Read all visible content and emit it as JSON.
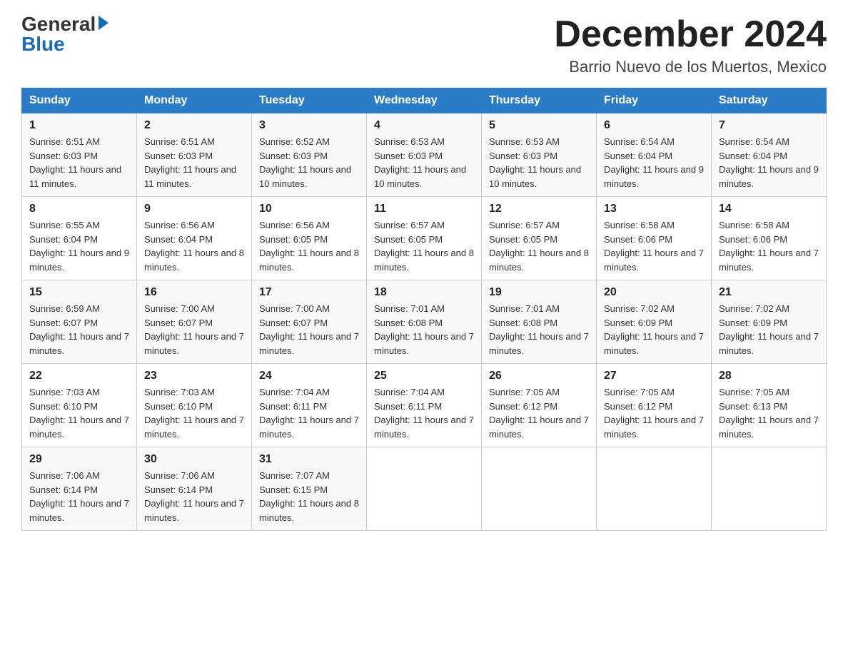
{
  "header": {
    "logo_general": "General",
    "logo_blue": "Blue",
    "month_title": "December 2024",
    "location": "Barrio Nuevo de los Muertos, Mexico"
  },
  "days_of_week": [
    "Sunday",
    "Monday",
    "Tuesday",
    "Wednesday",
    "Thursday",
    "Friday",
    "Saturday"
  ],
  "weeks": [
    [
      {
        "day": "1",
        "sunrise": "6:51 AM",
        "sunset": "6:03 PM",
        "daylight": "11 hours and 11 minutes."
      },
      {
        "day": "2",
        "sunrise": "6:51 AM",
        "sunset": "6:03 PM",
        "daylight": "11 hours and 11 minutes."
      },
      {
        "day": "3",
        "sunrise": "6:52 AM",
        "sunset": "6:03 PM",
        "daylight": "11 hours and 10 minutes."
      },
      {
        "day": "4",
        "sunrise": "6:53 AM",
        "sunset": "6:03 PM",
        "daylight": "11 hours and 10 minutes."
      },
      {
        "day": "5",
        "sunrise": "6:53 AM",
        "sunset": "6:03 PM",
        "daylight": "11 hours and 10 minutes."
      },
      {
        "day": "6",
        "sunrise": "6:54 AM",
        "sunset": "6:04 PM",
        "daylight": "11 hours and 9 minutes."
      },
      {
        "day": "7",
        "sunrise": "6:54 AM",
        "sunset": "6:04 PM",
        "daylight": "11 hours and 9 minutes."
      }
    ],
    [
      {
        "day": "8",
        "sunrise": "6:55 AM",
        "sunset": "6:04 PM",
        "daylight": "11 hours and 9 minutes."
      },
      {
        "day": "9",
        "sunrise": "6:56 AM",
        "sunset": "6:04 PM",
        "daylight": "11 hours and 8 minutes."
      },
      {
        "day": "10",
        "sunrise": "6:56 AM",
        "sunset": "6:05 PM",
        "daylight": "11 hours and 8 minutes."
      },
      {
        "day": "11",
        "sunrise": "6:57 AM",
        "sunset": "6:05 PM",
        "daylight": "11 hours and 8 minutes."
      },
      {
        "day": "12",
        "sunrise": "6:57 AM",
        "sunset": "6:05 PM",
        "daylight": "11 hours and 8 minutes."
      },
      {
        "day": "13",
        "sunrise": "6:58 AM",
        "sunset": "6:06 PM",
        "daylight": "11 hours and 7 minutes."
      },
      {
        "day": "14",
        "sunrise": "6:58 AM",
        "sunset": "6:06 PM",
        "daylight": "11 hours and 7 minutes."
      }
    ],
    [
      {
        "day": "15",
        "sunrise": "6:59 AM",
        "sunset": "6:07 PM",
        "daylight": "11 hours and 7 minutes."
      },
      {
        "day": "16",
        "sunrise": "7:00 AM",
        "sunset": "6:07 PM",
        "daylight": "11 hours and 7 minutes."
      },
      {
        "day": "17",
        "sunrise": "7:00 AM",
        "sunset": "6:07 PM",
        "daylight": "11 hours and 7 minutes."
      },
      {
        "day": "18",
        "sunrise": "7:01 AM",
        "sunset": "6:08 PM",
        "daylight": "11 hours and 7 minutes."
      },
      {
        "day": "19",
        "sunrise": "7:01 AM",
        "sunset": "6:08 PM",
        "daylight": "11 hours and 7 minutes."
      },
      {
        "day": "20",
        "sunrise": "7:02 AM",
        "sunset": "6:09 PM",
        "daylight": "11 hours and 7 minutes."
      },
      {
        "day": "21",
        "sunrise": "7:02 AM",
        "sunset": "6:09 PM",
        "daylight": "11 hours and 7 minutes."
      }
    ],
    [
      {
        "day": "22",
        "sunrise": "7:03 AM",
        "sunset": "6:10 PM",
        "daylight": "11 hours and 7 minutes."
      },
      {
        "day": "23",
        "sunrise": "7:03 AM",
        "sunset": "6:10 PM",
        "daylight": "11 hours and 7 minutes."
      },
      {
        "day": "24",
        "sunrise": "7:04 AM",
        "sunset": "6:11 PM",
        "daylight": "11 hours and 7 minutes."
      },
      {
        "day": "25",
        "sunrise": "7:04 AM",
        "sunset": "6:11 PM",
        "daylight": "11 hours and 7 minutes."
      },
      {
        "day": "26",
        "sunrise": "7:05 AM",
        "sunset": "6:12 PM",
        "daylight": "11 hours and 7 minutes."
      },
      {
        "day": "27",
        "sunrise": "7:05 AM",
        "sunset": "6:12 PM",
        "daylight": "11 hours and 7 minutes."
      },
      {
        "day": "28",
        "sunrise": "7:05 AM",
        "sunset": "6:13 PM",
        "daylight": "11 hours and 7 minutes."
      }
    ],
    [
      {
        "day": "29",
        "sunrise": "7:06 AM",
        "sunset": "6:14 PM",
        "daylight": "11 hours and 7 minutes."
      },
      {
        "day": "30",
        "sunrise": "7:06 AM",
        "sunset": "6:14 PM",
        "daylight": "11 hours and 7 minutes."
      },
      {
        "day": "31",
        "sunrise": "7:07 AM",
        "sunset": "6:15 PM",
        "daylight": "11 hours and 8 minutes."
      },
      null,
      null,
      null,
      null
    ]
  ]
}
